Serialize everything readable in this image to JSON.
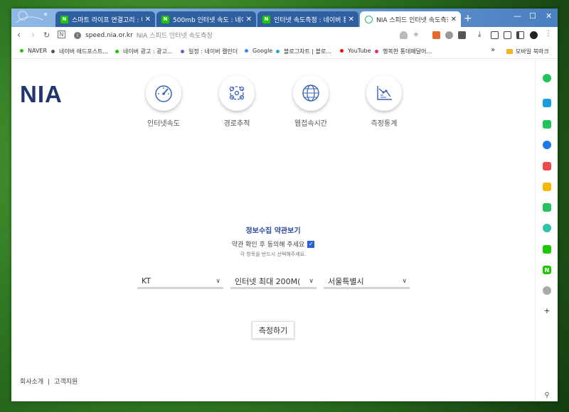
{
  "browser": {
    "tabs": [
      {
        "label": "스마트 라이프 연결고리 : 네이",
        "favicon_color": "#1ec800",
        "favicon_text": "N"
      },
      {
        "label": "500mb 인터넷 속도 : 네이버 통",
        "favicon_color": "#1ec800",
        "favicon_text": "N"
      },
      {
        "label": "인터넷 속도측정 : 네이버 통합",
        "favicon_color": "#1ec800",
        "favicon_text": "N"
      },
      {
        "label": "NIA 스피드 인터넷 속도측정",
        "favicon_color": "#2bb673",
        "favicon_text": "",
        "active": true
      }
    ],
    "address": {
      "url": "speed.nia.or.kr",
      "page_title": "NIA 스피드 인터넷 속도측정"
    },
    "bookmarks": [
      {
        "label": "NAVER",
        "color": "#1ec800"
      },
      {
        "label": "네이버 애드포스트...",
        "color": "#555555"
      },
      {
        "label": "네이버 광고 : 광고...",
        "color": "#1ec800"
      },
      {
        "label": "일정 : 네이버 캘린더",
        "color": "#6a5acd"
      },
      {
        "label": "Google",
        "color": "#4285f4"
      },
      {
        "label": "블로그차트 | 블로...",
        "color": "#2aa3d8"
      },
      {
        "label": "YouTube",
        "color": "#ff0000"
      },
      {
        "label": "행복한 통데매달어...",
        "color": "#e0345c"
      }
    ],
    "bookmarks_more": "»",
    "mobile_bookmarks": "모바일 북마크"
  },
  "page": {
    "logo": "NIA",
    "nav": [
      {
        "label": "인터넷속도",
        "icon": "speedometer-icon"
      },
      {
        "label": "경로추적",
        "icon": "route-trace-icon"
      },
      {
        "label": "웹접속시간",
        "icon": "globe-icon"
      },
      {
        "label": "측정통계",
        "icon": "statistics-icon"
      }
    ],
    "terms_link": "정보수집 약관보기",
    "agree_text": "약관 확인 후 동의해 주세요",
    "agree_sub": "각 항목을 반드시 선택해주세요.",
    "selects": {
      "isp": "KT",
      "plan": "인터넷 최대 200M(",
      "region": "서울특별시"
    },
    "measure_button": "측정하기",
    "footer": {
      "about": "회사소개",
      "support": "고객지원"
    }
  },
  "colors": {
    "brand_navy": "#23356e",
    "link_blue": "#2b4a9c",
    "tabbar_left": "#8fb9e6",
    "tabbar_right": "#4a7fc0"
  }
}
